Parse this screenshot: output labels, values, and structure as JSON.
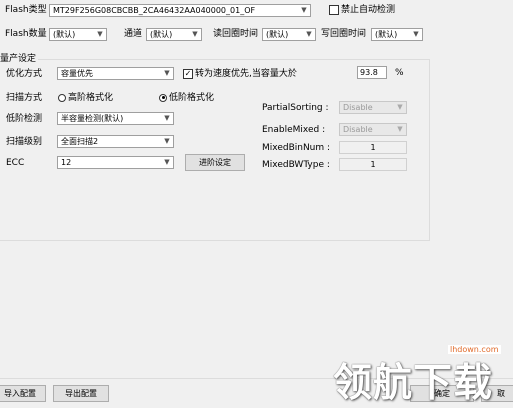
{
  "flash_type": {
    "label": "Flash类型",
    "value": "MT29F256G08CBCBB_2CA46432AA040000_01_OF"
  },
  "disable_auto_detect": {
    "label": "禁止自动检测",
    "checked": false
  },
  "row2": {
    "flash_count_label": "Flash数量",
    "flash_count_value": "(默认)",
    "channel_label": "通道",
    "channel_value": "(默认)",
    "read_timing_label": "读回圈时间",
    "read_timing_value": "(默认)",
    "write_timing_label": "写回圈时间",
    "write_timing_value": "(默认)"
  },
  "mass_production": {
    "title": "量产设定",
    "optimize_label": "优化方式",
    "optimize_value": "容量优先",
    "speed_priority": {
      "label": "转为速度优先,当容量大於",
      "checked": true
    },
    "threshold_value": "93.8",
    "threshold_unit": "%",
    "scan_mode_label": "扫描方式",
    "radio_high": {
      "label": "高阶格式化",
      "selected": false
    },
    "radio_low": {
      "label": "低阶格式化",
      "selected": true
    },
    "low_level_detect_label": "低阶检测",
    "low_level_detect_value": "半容量检测(默认)",
    "scan_level_label": "扫描级别",
    "scan_level_value": "全面扫描2",
    "ecc_label": "ECC",
    "ecc_value": "12",
    "advanced_button": "进阶设定",
    "partial_sorting_label": "PartialSorting :",
    "partial_sorting_value": "Disable",
    "enable_mixed_label": "EnableMixed :",
    "enable_mixed_value": "Disable",
    "mixed_bin_num_label": "MixedBinNum :",
    "mixed_bin_num_value": "1",
    "mixed_bw_type_label": "MixedBWType :",
    "mixed_bw_type_value": "1"
  },
  "footer": {
    "import_button": "导入配置",
    "export_button": "导出配置",
    "ok_button": "确定",
    "cancel_button": "取"
  },
  "watermark": {
    "text": "领航下载",
    "url": "lhdown.com"
  },
  "colors": {
    "accent": "#1a73c8",
    "disabled": "#9a9a9a"
  }
}
